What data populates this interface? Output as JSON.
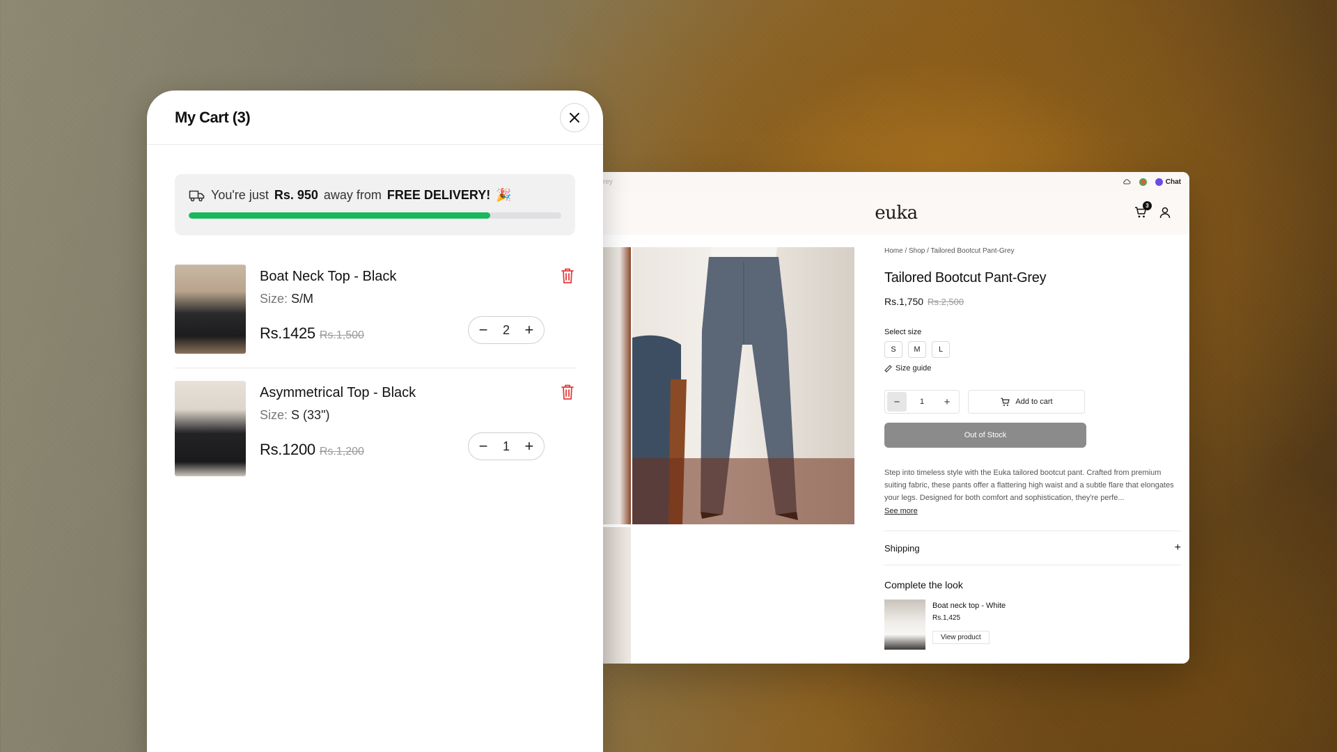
{
  "browser": {
    "url_fragment": "rey",
    "chat_label": "Chat",
    "logo": "euka",
    "cart_count": "3"
  },
  "product": {
    "breadcrumb": "Home / Shop / Tailored Bootcut Pant-Grey",
    "title": "Tailored Bootcut Pant-Grey",
    "price": "Rs.1,750",
    "price_was": "Rs.2,500",
    "select_size_label": "Select size",
    "sizes": [
      "S",
      "M",
      "L"
    ],
    "size_guide": "Size guide",
    "qty": "1",
    "add_to_cart": "Add to cart",
    "out_of_stock": "Out of Stock",
    "description": "Step into timeless style with the Euka tailored bootcut pant. Crafted from premium suiting fabric, these pants offer a flattering high waist and a subtle flare that elongates your legs. Designed for both comfort and sophistication, they're perfe...",
    "see_more": "See more",
    "shipping": "Shipping",
    "complete_the_look": "Complete the look",
    "look_item": {
      "name": "Boat neck top - White",
      "price": "Rs.1,425",
      "view": "View product"
    }
  },
  "cart": {
    "title": "My Cart (3)",
    "promo": {
      "prefix": "You're just",
      "amount": "Rs. 950",
      "middle": "away from",
      "free": "FREE DELIVERY!",
      "emoji": "🎉",
      "progress_percent": 81
    },
    "items": [
      {
        "name": "Boat Neck Top - Black",
        "size_label": "Size:",
        "size": "S/M",
        "price": "Rs.1425",
        "price_was": "Rs.1,500",
        "qty": "2"
      },
      {
        "name": "Asymmetrical Top - Black",
        "size_label": "Size:",
        "size": "S (33\")",
        "price": "Rs.1200",
        "price_was": "Rs.1,200",
        "qty": "1"
      }
    ]
  },
  "colors": {
    "progress": "#19b85c",
    "trash": "#e23b3b",
    "out_of_stock_bg": "#8b8b8b"
  }
}
